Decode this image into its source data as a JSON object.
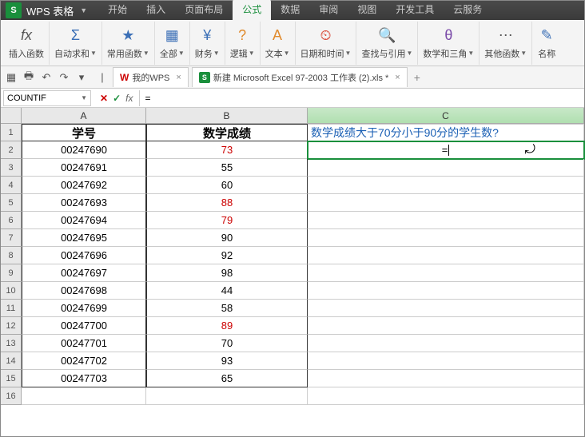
{
  "app": {
    "icon": "S",
    "title": "WPS 表格"
  },
  "tabs": {
    "items": [
      "开始",
      "插入",
      "页面布局",
      "公式",
      "数据",
      "审阅",
      "视图",
      "开发工具",
      "云服务"
    ],
    "active": 3
  },
  "ribbon": [
    {
      "icon": "fx",
      "label": "插入函数",
      "color": "#555"
    },
    {
      "icon": "Σ",
      "label": "自动求和",
      "color": "#3b6fb6",
      "dd": true
    },
    {
      "icon": "★",
      "label": "常用函数",
      "color": "#3b6fb6",
      "dd": true
    },
    {
      "icon": "▦",
      "label": "全部",
      "color": "#3b6fb6",
      "dd": true
    },
    {
      "icon": "¥",
      "label": "财务",
      "color": "#3b6fb6",
      "dd": true
    },
    {
      "icon": "?",
      "label": "逻辑",
      "color": "#e08a2c",
      "dd": true
    },
    {
      "icon": "A",
      "label": "文本",
      "color": "#e08a2c",
      "dd": true
    },
    {
      "icon": "⏲",
      "label": "日期和时间",
      "color": "#d94c3a",
      "dd": true
    },
    {
      "icon": "🔍",
      "label": "查找与引用",
      "color": "#3b6fb6",
      "dd": true
    },
    {
      "icon": "θ",
      "label": "数学和三角",
      "color": "#7a4aa8",
      "dd": true
    },
    {
      "icon": "⋯",
      "label": "其他函数",
      "color": "#555",
      "dd": true
    },
    {
      "icon": "✎",
      "label": "名称",
      "color": "#3b6fb6"
    }
  ],
  "qat": [
    "▦",
    "🖶",
    "↶",
    "↷",
    "▾"
  ],
  "doctabs": {
    "wps": {
      "icon": "W",
      "label": "我的WPS"
    },
    "file": {
      "label": "新建 Microsoft Excel 97-2003 工作表 (2).xls *"
    },
    "close": "×"
  },
  "formulaBar": {
    "name": "COUNTIF",
    "cancel": "✕",
    "confirm": "✓",
    "fx": "fx",
    "value": "="
  },
  "columns": [
    "A",
    "B",
    "C"
  ],
  "headers": {
    "A": "学号",
    "B": "数学成绩",
    "C": "数学成绩大于70分小于90分的学生数?"
  },
  "editing": {
    "value": "="
  },
  "rows": [
    {
      "a": "00247690",
      "b": "73",
      "red": true
    },
    {
      "a": "00247691",
      "b": "55"
    },
    {
      "a": "00247692",
      "b": "60"
    },
    {
      "a": "00247693",
      "b": "88",
      "red": true
    },
    {
      "a": "00247694",
      "b": "79",
      "red": true
    },
    {
      "a": "00247695",
      "b": "90"
    },
    {
      "a": "00247696",
      "b": "92"
    },
    {
      "a": "00247697",
      "b": "98"
    },
    {
      "a": "00247698",
      "b": "44"
    },
    {
      "a": "00247699",
      "b": "58"
    },
    {
      "a": "00247700",
      "b": "89",
      "red": true
    },
    {
      "a": "00247701",
      "b": "70"
    },
    {
      "a": "00247702",
      "b": "93"
    },
    {
      "a": "00247703",
      "b": "65"
    }
  ]
}
